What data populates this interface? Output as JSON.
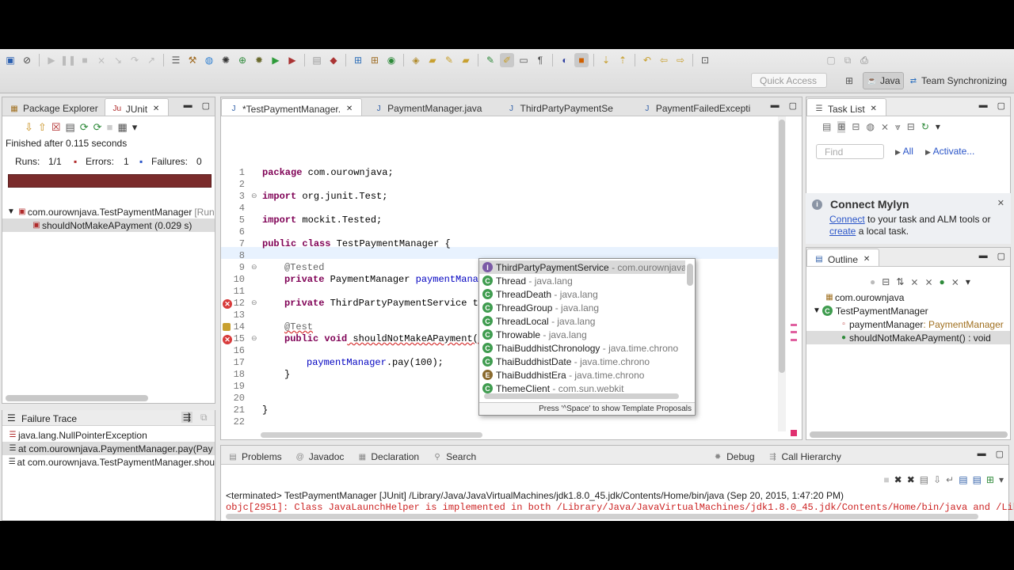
{
  "toolbar": {
    "quick_access_placeholder": "Quick Access",
    "perspective_java": "Java",
    "perspective_team": "Team Synchronizing"
  },
  "left_panel": {
    "tabs": [
      "Package Explorer",
      "JUnit"
    ],
    "finished": "Finished after 0.115 seconds",
    "runs_label": "Runs:",
    "runs_value": "1/1",
    "errors_label": "Errors:",
    "errors_value": "1",
    "failures_label": "Failures:",
    "failures_value": "0",
    "tree": [
      {
        "text": "com.ourownjava.TestPaymentManager",
        "suffix": "[Run"
      },
      {
        "text": "shouldNotMakeAPayment (0.029 s)"
      }
    ],
    "failure_trace_title": "Failure Trace",
    "trace": [
      "java.lang.NullPointerException",
      "at com.ourownjava.PaymentManager.pay(Pay",
      "at com.ourownjava.TestPaymentManager.shou"
    ]
  },
  "editor": {
    "tabs": [
      "*TestPaymentManager.",
      "PaymentManager.java",
      "ThirdPartyPaymentSe",
      "PaymentFailedExcepti"
    ],
    "line_numbers": [
      "1",
      "2",
      "3",
      "4",
      "5",
      "6",
      "7",
      "8",
      "9",
      "10",
      "11",
      "12",
      "13",
      "14",
      "15",
      "16",
      "17",
      "18",
      "19",
      "20",
      "21",
      "22"
    ],
    "code": {
      "l1_kw": "package",
      "l1_rest": " com.ourownjava;",
      "l3_kw": "import",
      "l3_rest": " org.junit.Test;",
      "l5_kw": "import",
      "l5_rest": " mockit.Tested;",
      "l7_kw1": "public",
      "l7_kw2": "class",
      "l7_rest": " TestPaymentManager {",
      "l9": "@Tested",
      "l10_kw": "private",
      "l10_type": " PaymentManager ",
      "l10_field": "paymentManager",
      "l10_end": ";",
      "l12_kw": "private",
      "l12_rest": " ThirdPartyPaymentService th",
      "l14": "@Test",
      "l15_kw1": "public",
      "l15_kw2": "void",
      "l15_rest": " shouldNotMakeAPayment()",
      "l17_field": "paymentManager",
      "l17_rest": ".pay(100);",
      "l18": "}",
      "l21": "}"
    },
    "proposals": [
      {
        "name": "ThirdPartyPaymentService",
        "pkg": "- com.ourownjava",
        "icon": "I",
        "color": "#7b5aa6"
      },
      {
        "name": "Thread",
        "pkg": "- java.lang",
        "icon": "C",
        "color": "#3f9c4f"
      },
      {
        "name": "ThreadDeath",
        "pkg": "- java.lang",
        "icon": "C",
        "color": "#3f9c4f"
      },
      {
        "name": "ThreadGroup",
        "pkg": "- java.lang",
        "icon": "C",
        "color": "#3f9c4f"
      },
      {
        "name": "ThreadLocal",
        "pkg": "- java.lang",
        "icon": "C",
        "color": "#3f9c4f"
      },
      {
        "name": "Throwable",
        "pkg": "- java.lang",
        "icon": "C",
        "color": "#3f9c4f"
      },
      {
        "name": "ThaiBuddhistChronology",
        "pkg": "- java.time.chrono",
        "icon": "C",
        "color": "#3f9c4f"
      },
      {
        "name": "ThaiBuddhistDate",
        "pkg": "- java.time.chrono",
        "icon": "C",
        "color": "#3f9c4f"
      },
      {
        "name": "ThaiBuddhistEra",
        "pkg": "- java.time.chrono",
        "icon": "E",
        "color": "#8a6a2e"
      },
      {
        "name": "ThemeClient",
        "pkg": "- com.sun.webkit",
        "icon": "C",
        "color": "#3f9c4f"
      }
    ],
    "popup_hint": "Press '^Space' to show Template Proposals"
  },
  "bottom_panel": {
    "tabs": [
      "Problems",
      "Javadoc",
      "Declaration",
      "Search",
      "Debug",
      "Call Hierarchy"
    ],
    "terminated": "<terminated> TestPaymentManager [JUnit] /Library/Java/JavaVirtualMachines/jdk1.8.0_45.jdk/Contents/Home/bin/java (Sep 20, 2015, 1:47:20 PM)",
    "output": "objc[2951]: Class JavaLaunchHelper is implemented in both /Library/Java/JavaVirtualMachines/jdk1.8.0_45.jdk/Contents/Home/bin/java and /Libr"
  },
  "task_list": {
    "title": "Task List",
    "find_placeholder": "Find",
    "all": "All",
    "activate": "Activate...",
    "mylyn_title": "Connect Mylyn",
    "mylyn_connect": "Connect",
    "mylyn_text1": " to your task and ALM tools or",
    "mylyn_create": "create",
    "mylyn_text2": " a local task."
  },
  "outline": {
    "title": "Outline",
    "items": [
      {
        "text": "com.ourownjava"
      },
      {
        "text": "TestPaymentManager"
      },
      {
        "text": "paymentManager",
        "type": " : PaymentManager"
      },
      {
        "text": "shouldNotMakeAPayment() : void"
      }
    ]
  },
  "colors": {
    "junit_fail_bar": "#7a2b2b",
    "keyword": "#7f0055",
    "field": "#0000c0",
    "link": "#2a55c8",
    "console_error": "#cc2222"
  }
}
